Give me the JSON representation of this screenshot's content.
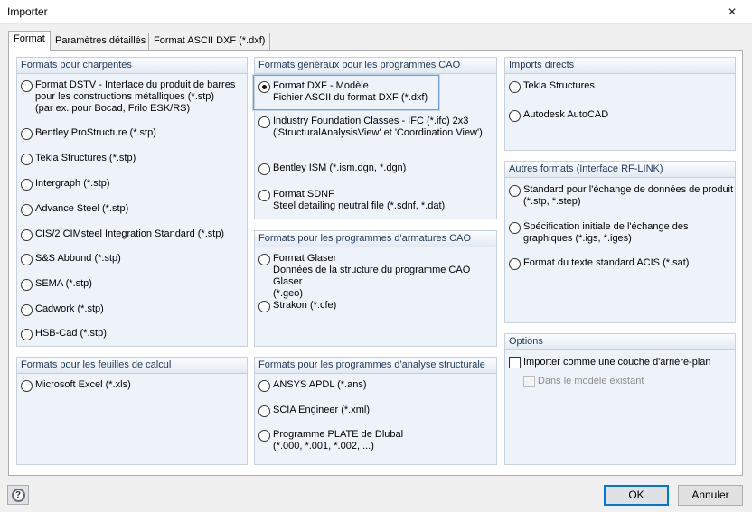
{
  "window": {
    "title": "Importer",
    "close_icon": "×"
  },
  "tabs": [
    {
      "label": "Format",
      "active": true
    },
    {
      "label": "Paramètres détaillés",
      "active": false
    },
    {
      "label": "Format ASCII DXF (*.dxf)",
      "active": false
    }
  ],
  "groups": {
    "charpentes": {
      "title": "Formats pour charpentes",
      "options": [
        {
          "lines": [
            "Format DSTV - Interface du produit de barres",
            "pour les constructions métalliques (*.stp)",
            "(par ex. pour Bocad, Frilo ESK/RS)"
          ]
        },
        {
          "lines": [
            "Bentley ProStructure (*.stp)"
          ]
        },
        {
          "lines": [
            "Tekla Structures (*.stp)"
          ]
        },
        {
          "lines": [
            "Intergraph (*.stp)"
          ]
        },
        {
          "lines": [
            "Advance Steel (*.stp)"
          ]
        },
        {
          "lines": [
            "CIS/2 CIMsteel Integration Standard (*.stp)"
          ]
        },
        {
          "lines": [
            "S&S Abbund (*.stp)"
          ]
        },
        {
          "lines": [
            "SEMA (*.stp)"
          ]
        },
        {
          "lines": [
            "Cadwork (*.stp)"
          ]
        },
        {
          "lines": [
            "HSB-Cad (*.stp)"
          ]
        }
      ]
    },
    "feuilles": {
      "title": "Formats pour les feuilles de calcul",
      "options": [
        {
          "lines": [
            "Microsoft Excel (*.xls)"
          ]
        }
      ]
    },
    "cao": {
      "title": "Formats généraux pour les programmes CAO",
      "options": [
        {
          "lines": [
            "Format DXF - Modèle",
            "Fichier ASCII du format DXF (*.dxf)"
          ],
          "checked": true
        },
        {
          "lines": [
            "Industry Foundation Classes - IFC (*.ifc) 2x3",
            "('StructuralAnalysisView' et 'Coordination View')"
          ]
        },
        {
          "lines": [
            "Bentley ISM (*.ism.dgn, *.dgn)"
          ]
        },
        {
          "lines": [
            "Format SDNF",
            "Steel detailing neutral file (*.sdnf, *.dat)"
          ]
        }
      ]
    },
    "armatures": {
      "title": "Formats pour les programmes d'armatures CAO",
      "options": [
        {
          "lines": [
            "Format Glaser",
            "Données de la structure du programme CAO Glaser",
            "(*.geo)"
          ]
        },
        {
          "lines": [
            "Strakon (*.cfe)"
          ]
        }
      ]
    },
    "analyse": {
      "title": "Formats pour les programmes d'analyse structurale",
      "options": [
        {
          "lines": [
            "ANSYS APDL (*.ans)"
          ]
        },
        {
          "lines": [
            "SCIA Engineer (*.xml)"
          ]
        },
        {
          "lines": [
            "Programme PLATE de Dlubal",
            "(*.000, *.001, *.002, ...)"
          ]
        }
      ]
    },
    "imports": {
      "title": "Imports directs",
      "options": [
        {
          "lines": [
            "Tekla Structures"
          ]
        },
        {
          "lines": [
            "Autodesk AutoCAD"
          ]
        }
      ]
    },
    "rflink": {
      "title": "Autres formats (Interface RF-LINK)",
      "options": [
        {
          "lines": [
            "Standard pour l'échange de données de produit",
            "(*.stp, *.step)"
          ]
        },
        {
          "lines": [
            "Spécification initiale de l'échange des",
            "graphiques (*.igs, *.iges)"
          ]
        },
        {
          "lines": [
            "Format du texte standard ACIS (*.sat)"
          ]
        }
      ]
    },
    "options": {
      "title": "Options",
      "background_layer": {
        "label": "Importer comme une couche d'arrière-plan",
        "checked": false
      },
      "existing_model": {
        "label": "Dans le modèle existant",
        "checked": false,
        "disabled": true
      }
    }
  },
  "buttons": {
    "ok": "OK",
    "cancel": "Annuler",
    "help_icon": "?"
  }
}
